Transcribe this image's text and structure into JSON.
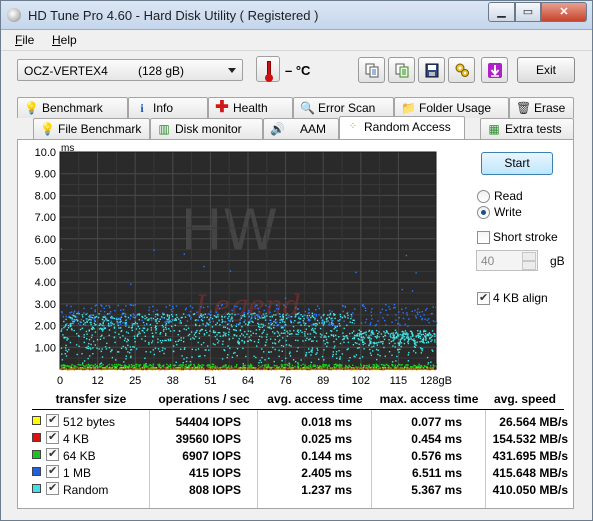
{
  "window": {
    "title": "HD Tune Pro 4.60 - Hard Disk Utility (  Registered )",
    "minimize_glyph": "▁",
    "maximize_glyph": "▭",
    "close_glyph": "✕"
  },
  "menu": {
    "file": {
      "hotkey": "F",
      "rest": "ile"
    },
    "help": {
      "hotkey": "H",
      "rest": "elp"
    }
  },
  "toolbar": {
    "drive_name": "OCZ-VERTEX4",
    "drive_size": "(128 gB)",
    "temperature": "– °C",
    "icons": [
      "copy-icon",
      "copy-info-icon",
      "save-icon",
      "options-icon",
      "download-icon"
    ],
    "exit_label": "Exit"
  },
  "tabs_row1": [
    {
      "label": "Benchmark",
      "icon": "bulb-icon"
    },
    {
      "label": "Info",
      "icon": "info-icon"
    },
    {
      "label": "Health",
      "icon": "health-cross-icon"
    },
    {
      "label": "Error Scan",
      "icon": "magnifier-icon"
    },
    {
      "label": "Folder Usage",
      "icon": "folder-icon"
    },
    {
      "label": "Erase",
      "icon": "trash-icon"
    }
  ],
  "tabs_row2": [
    {
      "label": "File Benchmark",
      "icon": "file-bulb-icon"
    },
    {
      "label": "Disk monitor",
      "icon": "monitor-chart-icon"
    },
    {
      "label": "AAM",
      "icon": "speaker-icon"
    },
    {
      "label": "Random Access",
      "icon": "random-dots-icon",
      "active": true
    },
    {
      "label": "Extra tests",
      "icon": "extra-tests-icon"
    }
  ],
  "controls": {
    "start_label": "Start",
    "read_label": "Read",
    "write_label": "Write",
    "selected_mode": "Write",
    "short_stroke_label": "Short stroke",
    "short_stroke_checked": false,
    "short_stroke_value": "40",
    "short_stroke_unit": "gB",
    "align_label": "4 KB align",
    "align_checked": true
  },
  "chart_data": {
    "type": "scatter",
    "ylabel": "ms",
    "y_ticks": [
      "10.0",
      "9.00",
      "8.00",
      "7.00",
      "6.00",
      "5.00",
      "4.00",
      "3.00",
      "2.00",
      "1.00"
    ],
    "x_ticks": [
      "0",
      "12",
      "25",
      "38",
      "51",
      "64",
      "76",
      "89",
      "102",
      "115",
      "128gB"
    ],
    "xlim": [
      0,
      128
    ],
    "ylim": [
      0,
      10
    ],
    "grid": true,
    "background": "#2a2a2a",
    "watermark_text": "HW Legend",
    "series": [
      {
        "name": "512 bytes",
        "color": "#ffff00",
        "band": [
          0.0,
          0.08
        ],
        "mean_access_ms": 0.018
      },
      {
        "name": "4 KB",
        "color": "#ff2020",
        "band": [
          0.0,
          0.1
        ],
        "mean_access_ms": 0.025
      },
      {
        "name": "64 KB",
        "color": "#20d020",
        "band": [
          0.1,
          0.25
        ],
        "mean_access_ms": 0.144
      },
      {
        "name": "1 MB",
        "color": "#2a78ff",
        "band": [
          2.0,
          3.0
        ],
        "mean_access_ms": 2.405
      },
      {
        "name": "Random",
        "color": "#40e8e8",
        "band": [
          0.2,
          2.6
        ],
        "mean_access_ms": 1.237
      }
    ]
  },
  "results": {
    "headers": [
      "transfer size",
      "operations / sec",
      "avg. access time",
      "max. access time",
      "avg. speed"
    ],
    "rows": [
      {
        "size": "512 bytes",
        "color": "#ffff00",
        "iops": "54404 IOPS",
        "avg": "0.018 ms",
        "max": "0.077 ms",
        "speed": "26.564 MB/s"
      },
      {
        "size": "4 KB",
        "color": "#e01010",
        "iops": "39560 IOPS",
        "avg": "0.025 ms",
        "max": "0.454 ms",
        "speed": "154.532 MB/s"
      },
      {
        "size": "64 KB",
        "color": "#20c020",
        "iops": "6907 IOPS",
        "avg": "0.144 ms",
        "max": "0.576 ms",
        "speed": "431.695 MB/s"
      },
      {
        "size": "1 MB",
        "color": "#2060e0",
        "iops": "415 IOPS",
        "avg": "2.405 ms",
        "max": "6.511 ms",
        "speed": "415.648 MB/s"
      },
      {
        "size": "Random",
        "color": "#40e0e8",
        "iops": "808 IOPS",
        "avg": "1.237 ms",
        "max": "5.367 ms",
        "speed": "410.050 MB/s"
      }
    ]
  }
}
